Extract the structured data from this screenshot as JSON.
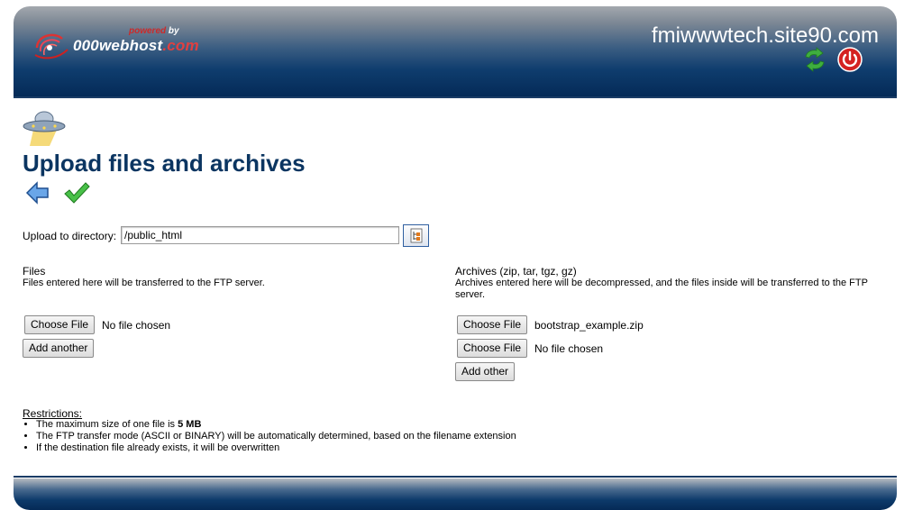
{
  "header": {
    "logo_powered": "powered",
    "logo_by": "by",
    "logo_name_main": "000webhost",
    "logo_name_tld": ".com",
    "site_title": "fmiwwwtech.site90.com",
    "icons": [
      "refresh-icon",
      "power-icon"
    ],
    "colors": {
      "gradient_top": "#a3a8ae",
      "gradient_bottom": "#042a57",
      "power_red": "#d42222",
      "refresh_green": "#3fae3f"
    }
  },
  "page": {
    "title": "Upload files and archives",
    "icons": [
      "ufo-icon",
      "back-arrow-icon",
      "checkmark-icon",
      "directory-tree-icon"
    ]
  },
  "directory": {
    "label": "Upload to directory:",
    "value": "/public_html"
  },
  "files": {
    "title": "Files",
    "description": "Files entered here will be transferred to the FTP server.",
    "choose_label": "Choose File",
    "inputs": [
      {
        "status": "No file chosen"
      }
    ],
    "add_label": "Add another"
  },
  "archives": {
    "title": "Archives (zip, tar, tgz, gz)",
    "description": "Archives entered here will be decompressed, and the files inside will be transferred to the FTP server.",
    "choose_label": "Choose File",
    "inputs": [
      {
        "status": "bootstrap_example.zip"
      },
      {
        "status": "No file chosen"
      }
    ],
    "add_label": "Add other"
  },
  "restrictions": {
    "title": "Restrictions:",
    "item1_prefix": "The maximum size of one file is ",
    "item1_value": "5 MB",
    "item2": "The FTP transfer mode (ASCII or BINARY) will be automatically determined, based on the filename extension",
    "item3": "If the destination file already exists, it will be overwritten"
  }
}
